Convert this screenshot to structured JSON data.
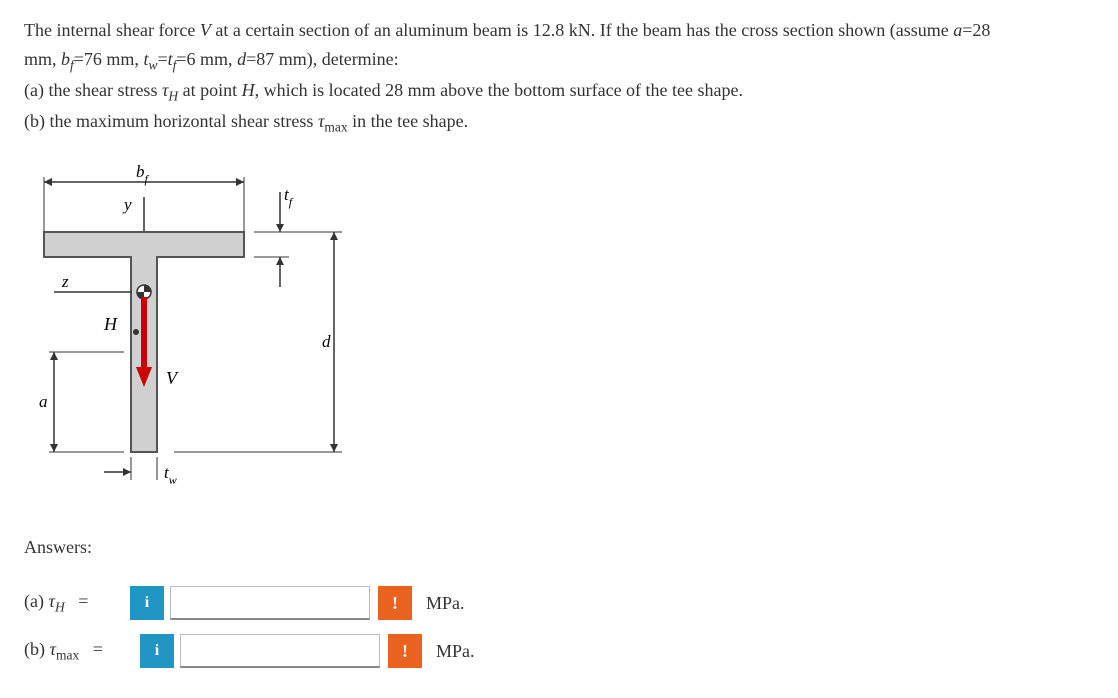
{
  "problem": {
    "line1_a": "The internal shear force ",
    "line1_v": "V",
    "line1_b": " at a certain section of an aluminum beam is 12.8 kN. If the beam has the cross section shown (assume ",
    "line1_a_var": "a",
    "line1_c": "=28",
    "line2_a": "mm, ",
    "line2_bf": "b",
    "line2_bf_sub": "f",
    "line2_b": "=76 mm, ",
    "line2_tw": "t",
    "line2_tw_sub": "w",
    "line2_c": "=",
    "line2_tf": "t",
    "line2_tf_sub": "f",
    "line2_d": "=6 mm, ",
    "line2_d_var": "d",
    "line2_e": "=87 mm), determine:",
    "line3_a": "(a) the shear stress ",
    "line3_tau": "τ",
    "line3_tau_sub": "H",
    "line3_b": " at point ",
    "line3_h": "H",
    "line3_c": ", which is located 28 mm above the bottom surface of the tee shape.",
    "line4_a": "(b) the maximum horizontal shear stress ",
    "line4_tau": "τ",
    "line4_tau_sub": "max",
    "line4_b": " in the tee shape."
  },
  "diagram": {
    "bf": "b",
    "bf_sub": "f",
    "y": "y",
    "tf": "t",
    "tf_sub": "f",
    "z": "z",
    "H": "H",
    "a": "a",
    "V": "V",
    "d": "d",
    "tw": "t",
    "tw_sub": "w"
  },
  "answers": {
    "label": "Answers:",
    "a_label_open": "(a) ",
    "a_tau": "τ",
    "a_tau_sub": "H",
    "a_eq": "   =",
    "b_label_open": "(b) ",
    "b_tau": "τ",
    "b_tau_sub": "max",
    "b_eq": "   =",
    "info": "i",
    "warn": "!",
    "unit": "MPa."
  }
}
